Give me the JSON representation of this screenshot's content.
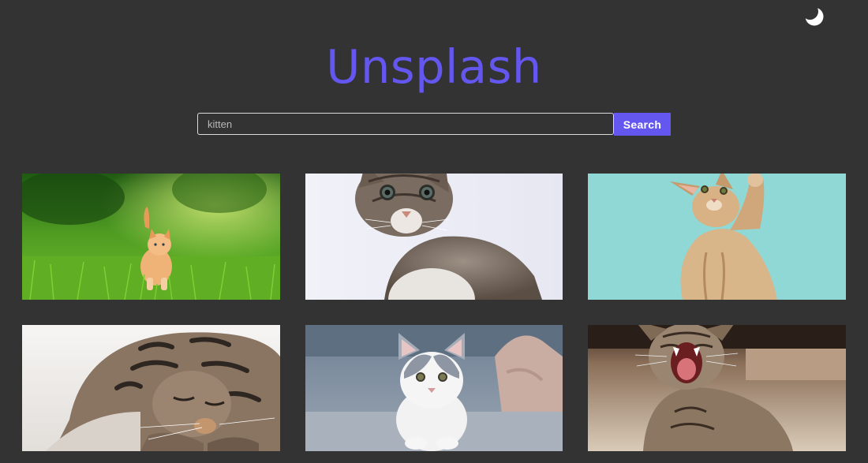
{
  "app": {
    "title": "Unsplash"
  },
  "theme_toggle": {
    "icon": "moon-icon",
    "color": "#ffffff"
  },
  "search": {
    "value": "kitten",
    "button_label": "Search"
  },
  "colors": {
    "background": "#333333",
    "accent": "#6457f0"
  },
  "results": [
    {
      "icon": "orange-kitten-in-grass-photo"
    },
    {
      "icon": "tabby-kitten-on-white-photo"
    },
    {
      "icon": "kitten-reaching-up-on-teal-photo"
    },
    {
      "icon": "sleeping-tabby-kitten-photo"
    },
    {
      "icon": "white-grey-kitten-on-sofa-photo"
    },
    {
      "icon": "yawning-tabby-kitten-photo"
    }
  ]
}
